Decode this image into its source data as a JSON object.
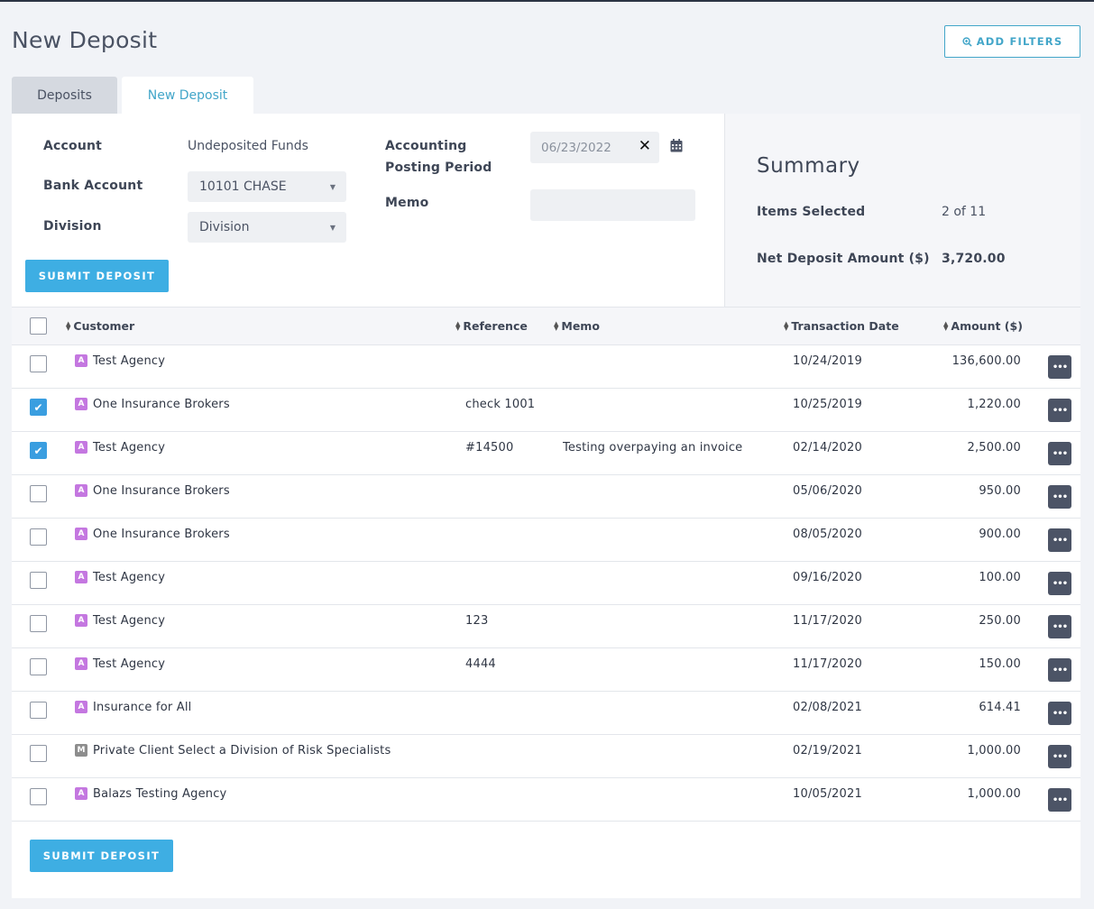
{
  "page": {
    "title": "New Deposit"
  },
  "toolbar": {
    "add_filters_label": "ADD FILTERS"
  },
  "tabs": [
    {
      "label": "Deposits",
      "active": false
    },
    {
      "label": "New Deposit",
      "active": true
    }
  ],
  "form": {
    "account_label": "Account",
    "account_value": "Undeposited Funds",
    "bank_account_label": "Bank Account",
    "bank_account_value": "10101 CHASE",
    "division_label": "Division",
    "division_value": "Division",
    "posting_period_label_line1": "Accounting",
    "posting_period_label_line2": "Posting Period",
    "posting_period_value": "06/23/2022",
    "memo_label": "Memo",
    "memo_value": "",
    "submit_label": "SUBMIT DEPOSIT"
  },
  "summary": {
    "title": "Summary",
    "items_selected_label": "Items Selected",
    "items_selected_value": "2 of 11",
    "net_amount_label": "Net Deposit Amount ($)",
    "net_amount_value": "3,720.00"
  },
  "table": {
    "columns": {
      "customer": "Customer",
      "reference": "Reference",
      "memo": "Memo",
      "transaction_date": "Transaction Date",
      "amount": "Amount ($)"
    },
    "rows": [
      {
        "checked": false,
        "type": "A",
        "customer": "Test Agency",
        "reference": "",
        "memo": "",
        "date": "10/24/2019",
        "amount": "136,600.00"
      },
      {
        "checked": true,
        "type": "A",
        "customer": "One Insurance Brokers",
        "reference": "check 1001",
        "memo": "",
        "date": "10/25/2019",
        "amount": "1,220.00"
      },
      {
        "checked": true,
        "type": "A",
        "customer": "Test Agency",
        "reference": "#14500",
        "memo": "Testing overpaying an invoice",
        "date": "02/14/2020",
        "amount": "2,500.00"
      },
      {
        "checked": false,
        "type": "A",
        "customer": "One Insurance Brokers",
        "reference": "",
        "memo": "",
        "date": "05/06/2020",
        "amount": "950.00"
      },
      {
        "checked": false,
        "type": "A",
        "customer": "One Insurance Brokers",
        "reference": "",
        "memo": "",
        "date": "08/05/2020",
        "amount": "900.00"
      },
      {
        "checked": false,
        "type": "A",
        "customer": "Test Agency",
        "reference": "",
        "memo": "",
        "date": "09/16/2020",
        "amount": "100.00"
      },
      {
        "checked": false,
        "type": "A",
        "customer": "Test Agency",
        "reference": "123",
        "memo": "",
        "date": "11/17/2020",
        "amount": "250.00"
      },
      {
        "checked": false,
        "type": "A",
        "customer": "Test Agency",
        "reference": "4444",
        "memo": "",
        "date": "11/17/2020",
        "amount": "150.00"
      },
      {
        "checked": false,
        "type": "A",
        "customer": "Insurance for All",
        "reference": "",
        "memo": "",
        "date": "02/08/2021",
        "amount": "614.41"
      },
      {
        "checked": false,
        "type": "M",
        "customer": "Private Client Select a Division of Risk Specialists",
        "reference": "",
        "memo": "",
        "date": "02/19/2021",
        "amount": "1,000.00"
      },
      {
        "checked": false,
        "type": "A",
        "customer": "Balazs Testing Agency",
        "reference": "",
        "memo": "",
        "date": "10/05/2021",
        "amount": "1,000.00"
      }
    ]
  },
  "footer": {
    "submit_label": "SUBMIT DEPOSIT"
  },
  "colors": {
    "accent": "#3eaee3",
    "badge_a": "#c477e0",
    "badge_m": "#8d8d8d",
    "checked": "#3a9ee0",
    "more_button": "#4c5466"
  },
  "icons": {
    "add_filters": "search-plus-icon",
    "calendar": "calendar-icon",
    "clear": "close-icon",
    "sort": "sort-icon",
    "dropdown": "caret-down-icon",
    "row_more": "more-horizontal-icon"
  }
}
